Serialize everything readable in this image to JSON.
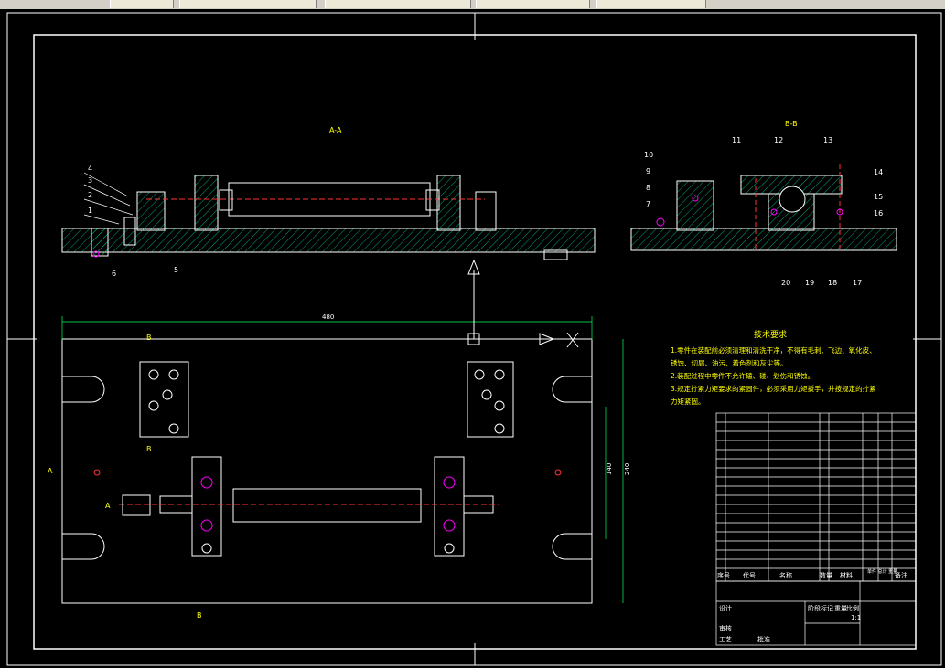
{
  "toolbar": {
    "buttons": [
      "",
      "",
      "",
      "",
      "",
      ""
    ],
    "colors": {
      "bar": "#d4d0c8"
    }
  },
  "drawing": {
    "section_aa_label": "A-A",
    "section_bb_label": "B-B",
    "dimension_length": "480",
    "dimension_width_outer": "240",
    "dimension_width_inner": "140",
    "view_marker_b_top": "B",
    "view_marker_b_mid": "B",
    "view_marker_b_bottom": "B",
    "view_marker_a_left": "A",
    "view_marker_a_right": "A",
    "part_numbers_left": [
      "4",
      "3",
      "2",
      "1",
      "6",
      "5"
    ],
    "part_numbers_right": [
      "10",
      "9",
      "8",
      "7",
      "11",
      "12",
      "13",
      "14",
      "15",
      "16",
      "17",
      "18",
      "19",
      "20"
    ],
    "tech_requirements": {
      "title": "技术要求",
      "lines": [
        "1.零件在装配前必须清理和清洗干净，不得有毛刺、飞边、氧化皮、",
        "锈蚀、切屑、油污、着色剂和灰尘等。",
        "2.装配过程中零件不允许磕、碰、划伤和锈蚀。",
        "3.规定拧紧力矩要求的紧固件，必须采用力矩扳手，并按规定的拧紧",
        "力矩紧固。"
      ]
    },
    "title_block": {
      "header_seq": "序号",
      "header_code": "代号",
      "header_name": "名称",
      "header_qty": "数量",
      "header_material": "材料",
      "header_weight": "单件 总计 重量",
      "header_note": "备注",
      "label_stage": "阶段标记",
      "label_weight": "重量",
      "label_scale": "比例",
      "scale_value": "1:1",
      "label_design": "设计",
      "label_check": "审核",
      "label_process": "工艺",
      "label_approve": "批准"
    },
    "colors": {
      "background": "#000000",
      "lines": "#ffffff",
      "hatch": "#00cc99",
      "centerline": "#ff3333",
      "highlight": "#ff00ff",
      "text": "#ffff00",
      "dimension": "#00ff66"
    }
  }
}
